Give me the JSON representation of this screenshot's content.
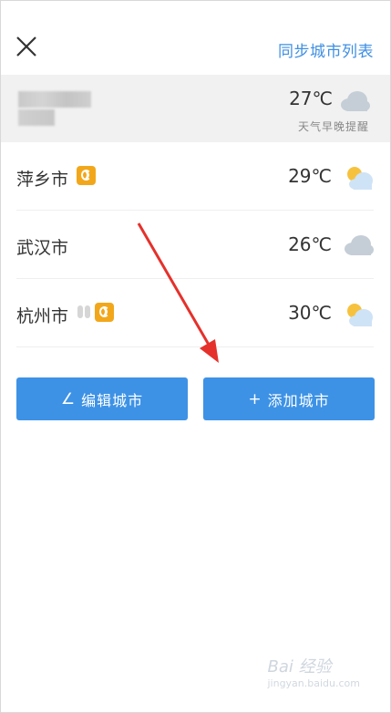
{
  "header": {
    "sync_label": "同步城市列表"
  },
  "current": {
    "temp": "27℃",
    "weather_icon": "cloud-icon",
    "remind_label": "天气早晚提醒"
  },
  "cities": [
    {
      "name": "萍乡市",
      "temp": "29℃",
      "weather_icon": "partly-cloudy-icon"
    },
    {
      "name": "武汉市",
      "temp": "26℃",
      "weather_icon": "cloud-icon"
    },
    {
      "name": "杭州市",
      "temp": "30℃",
      "weather_icon": "partly-cloudy-icon"
    }
  ],
  "buttons": {
    "edit_label": "编辑城市",
    "add_label": "添加城市"
  },
  "watermark": {
    "text": "Bai 经验",
    "url": "jingyan.baidu.com"
  },
  "colors": {
    "accent": "#3d92e6",
    "link": "#3f8fe3",
    "arrow": "#e5312b"
  }
}
